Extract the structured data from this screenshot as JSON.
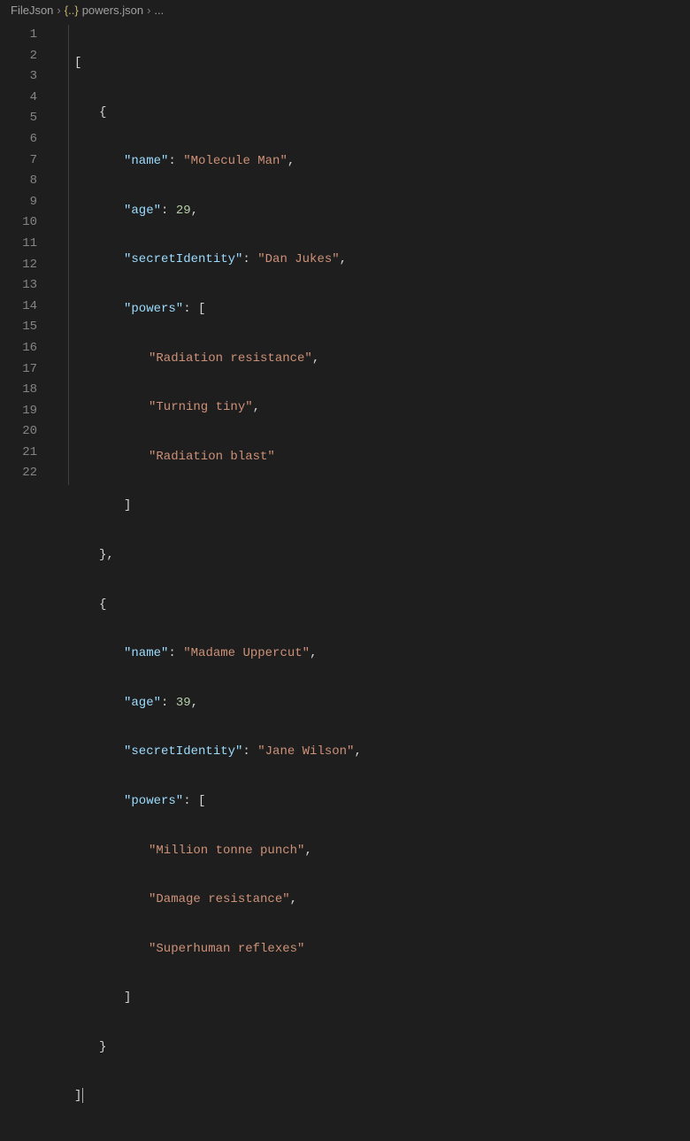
{
  "breadcrumb": {
    "folder": "FileJson",
    "icon_label": "{..}",
    "file": "powers.json",
    "trailing": "..."
  },
  "keys": {
    "name": "\"name\"",
    "age": "\"age\"",
    "secretIdentity": "\"secretIdentity\"",
    "powers": "\"powers\""
  },
  "hero1": {
    "name": "\"Molecule Man\"",
    "age": "29",
    "secretIdentity": "\"Dan Jukes\"",
    "p1": "\"Radiation resistance\"",
    "p2": "\"Turning tiny\"",
    "p3": "\"Radiation blast\""
  },
  "hero2": {
    "name": "\"Madame Uppercut\"",
    "age": "39",
    "secretIdentity": "\"Jane Wilson\"",
    "p1": "\"Million tonne punch\"",
    "p2": "\"Damage resistance\"",
    "p3": "\"Superhuman reflexes\""
  },
  "lines": {
    "l1": "1",
    "l2": "2",
    "l3": "3",
    "l4": "4",
    "l5": "5",
    "l6": "6",
    "l7": "7",
    "l8": "8",
    "l9": "9",
    "l10": "10",
    "l11": "11",
    "l12": "12",
    "l13": "13",
    "l14": "14",
    "l15": "15",
    "l16": "16",
    "l17": "17",
    "l18": "18",
    "l19": "19",
    "l20": "20",
    "l21": "21",
    "l22": "22"
  },
  "punct": {
    "open_arr": "[",
    "close_arr": "]",
    "open_obj": "{",
    "close_obj": "}",
    "close_obj_comma": "},",
    "colon": ": ",
    "comma": ","
  }
}
